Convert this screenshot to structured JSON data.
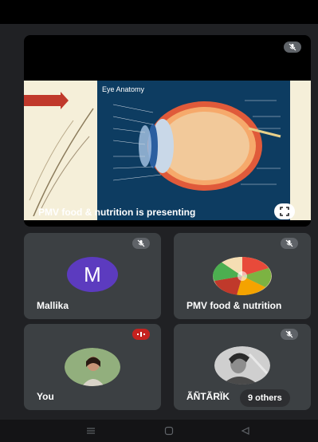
{
  "presenter": {
    "slide_title": "Eye Anatomy",
    "caption": "PMV food & nutrition is presenting",
    "muted_icon": "mic-off-icon",
    "fullscreen_icon": "fullscreen-icon"
  },
  "participants": [
    {
      "name": "Mallika",
      "avatar_letter": "M",
      "avatar_color": "#5c3bbf",
      "mic": "muted"
    },
    {
      "name": "PMV food & nutrition",
      "avatar": "food-photo",
      "mic": "muted"
    },
    {
      "name": "You",
      "avatar": "profile-photo",
      "mic": "speaking",
      "speaking_color": "#c5221f"
    },
    {
      "name": "ÃÑTÃRÏK",
      "avatar": "profile-photo",
      "mic": "muted"
    }
  ],
  "others_chip": "9 others",
  "navbar": {
    "menu_icon": "menu-icon",
    "home_icon": "home-icon",
    "back_icon": "back-icon"
  }
}
